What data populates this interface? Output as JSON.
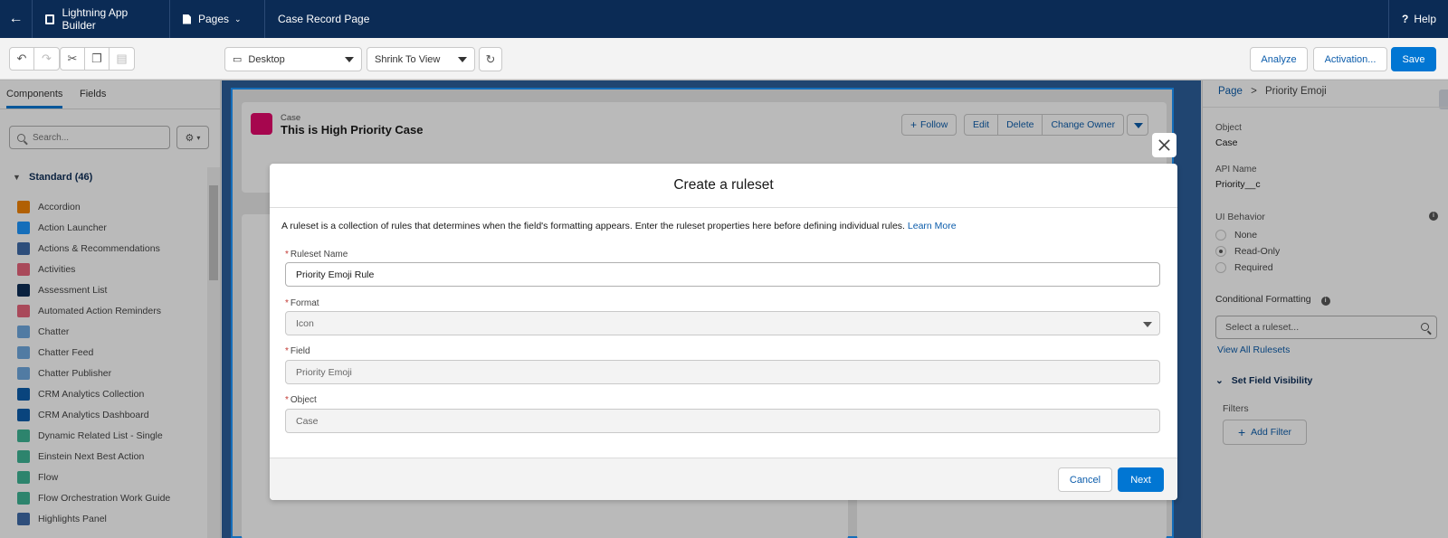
{
  "header": {
    "back_icon": "arrow-left-icon",
    "app_name": "Lightning App Builder",
    "pages_label": "Pages",
    "page_name": "Case Record Page",
    "help_label": "Help"
  },
  "toolbar": {
    "device_select": "Desktop",
    "zoom_select": "Shrink To View",
    "analyze_label": "Analyze",
    "activation_label": "Activation...",
    "save_label": "Save"
  },
  "left_panel": {
    "tabs": [
      "Components",
      "Fields"
    ],
    "search_placeholder": "Search...",
    "section_title": "Standard (46)",
    "components": [
      {
        "label": "Accordion",
        "color": "#f38303"
      },
      {
        "label": "Action Launcher",
        "color": "#1b96ff"
      },
      {
        "label": "Actions & Recommendations",
        "color": "#3d6aa8"
      },
      {
        "label": "Activities",
        "color": "#e8637b"
      },
      {
        "label": "Assessment List",
        "color": "#0b2b55"
      },
      {
        "label": "Automated Action Reminders",
        "color": "#e8637b"
      },
      {
        "label": "Chatter",
        "color": "#6ea8e0"
      },
      {
        "label": "Chatter Feed",
        "color": "#6ea8e0"
      },
      {
        "label": "Chatter Publisher",
        "color": "#6ea8e0"
      },
      {
        "label": "CRM Analytics Collection",
        "color": "#0b5cab"
      },
      {
        "label": "CRM Analytics Dashboard",
        "color": "#0b5cab"
      },
      {
        "label": "Dynamic Related List - Single",
        "color": "#3cb495"
      },
      {
        "label": "Einstein Next Best Action",
        "color": "#3cb495"
      },
      {
        "label": "Flow",
        "color": "#3cb495"
      },
      {
        "label": "Flow Orchestration Work Guide",
        "color": "#3cb495"
      },
      {
        "label": "Highlights Panel",
        "color": "#3d6aa8"
      }
    ]
  },
  "record": {
    "object_type": "Case",
    "title": "This is High Priority Case",
    "buttons": [
      "Follow",
      "Edit",
      "Delete",
      "Change Owner"
    ]
  },
  "right_panel": {
    "breadcrumb_page": "Page",
    "breadcrumb_sep": ">",
    "breadcrumb_current": "Priority Emoji",
    "object_label": "Object",
    "object_value": "Case",
    "api_label": "API Name",
    "api_value": "Priority__c",
    "ui_behavior_label": "UI Behavior",
    "ui_options": [
      "None",
      "Read-Only",
      "Required"
    ],
    "ui_selected": "Read-Only",
    "conditional_label": "Conditional Formatting",
    "ruleset_placeholder": "Select a ruleset...",
    "view_all_link": "View All Rulesets",
    "visibility_label": "Set Field Visibility",
    "filters_label": "Filters",
    "add_filter_label": "Add Filter"
  },
  "modal": {
    "title": "Create a ruleset",
    "description": "A ruleset is a collection of rules that determines when the field's formatting appears. Enter the ruleset properties here before defining individual rules.",
    "learn_more": "Learn More",
    "fields": {
      "ruleset_name": {
        "label": "Ruleset Name",
        "value": "Priority Emoji Rule"
      },
      "format": {
        "label": "Format",
        "value": "Icon"
      },
      "field": {
        "label": "Field",
        "value": "Priority Emoji"
      },
      "object": {
        "label": "Object",
        "value": "Case"
      }
    },
    "cancel_label": "Cancel",
    "next_label": "Next"
  }
}
